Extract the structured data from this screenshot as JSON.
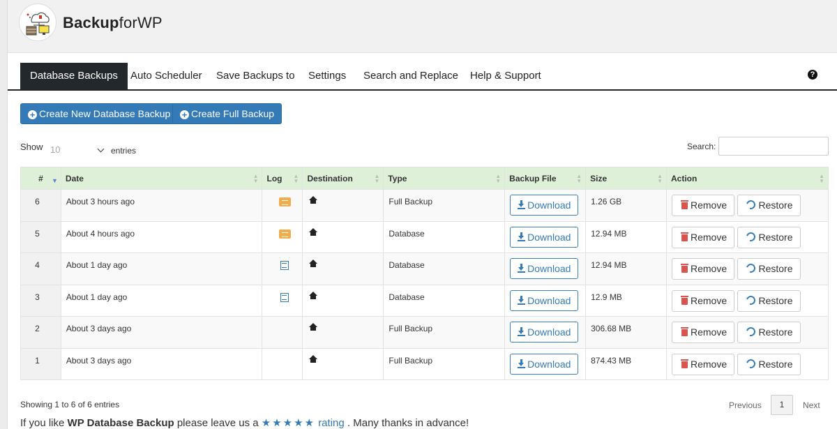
{
  "brand": {
    "bold": "Backup",
    "light": "forWP"
  },
  "tabs": [
    {
      "label": "Database Backups",
      "active": true
    },
    {
      "label": "Auto Scheduler",
      "active": false
    },
    {
      "label": "Save Backups to",
      "active": false
    },
    {
      "label": "Settings",
      "active": false
    },
    {
      "label": "Search and Replace",
      "active": false
    },
    {
      "label": "Help & Support",
      "active": false
    }
  ],
  "help_icon": "question-circle-icon",
  "actions": {
    "create_db": "Create New Database Backup",
    "create_full": "Create Full Backup"
  },
  "length": {
    "show": "Show",
    "value": "10",
    "entries": "entries"
  },
  "search": {
    "label": "Search:",
    "value": ""
  },
  "columns": [
    "#",
    "Date",
    "Log",
    "Destination",
    "Type",
    "Backup File",
    "Size",
    "Action"
  ],
  "rows": [
    {
      "num": "6",
      "date": "About 3 hours ago",
      "log": "orange",
      "type": "Full Backup",
      "size": "1.26 GB"
    },
    {
      "num": "5",
      "date": "About 4 hours ago",
      "log": "orange",
      "type": "Database",
      "size": "12.94 MB"
    },
    {
      "num": "4",
      "date": "About 1 day ago",
      "log": "blue",
      "type": "Database",
      "size": "12.94 MB"
    },
    {
      "num": "3",
      "date": "About 1 day ago",
      "log": "blue",
      "type": "Database",
      "size": "12.9 MB"
    },
    {
      "num": "2",
      "date": "About 3 days ago",
      "log": "",
      "type": "Full Backup",
      "size": "306.68 MB"
    },
    {
      "num": "1",
      "date": "About 3 days ago",
      "log": "",
      "type": "Full Backup",
      "size": "874.43 MB"
    }
  ],
  "row_buttons": {
    "download": "Download",
    "remove": "Remove",
    "restore": "Restore"
  },
  "info": "Showing 1 to 6 of 6 entries",
  "pager": {
    "previous": "Previous",
    "page": "1",
    "next": "Next"
  },
  "footer": {
    "prefix": "If you like",
    "product": "WP Database Backup",
    "middle": "please leave us a",
    "stars": "★★★★★",
    "rating": "rating",
    "suffix": ". Many thanks in advance!"
  },
  "colors": {
    "accent": "#337ab7",
    "header_row": "#dff0d8",
    "warning": "#f0ad4e",
    "danger": "#d9534f",
    "tab_active": "#23282d"
  }
}
